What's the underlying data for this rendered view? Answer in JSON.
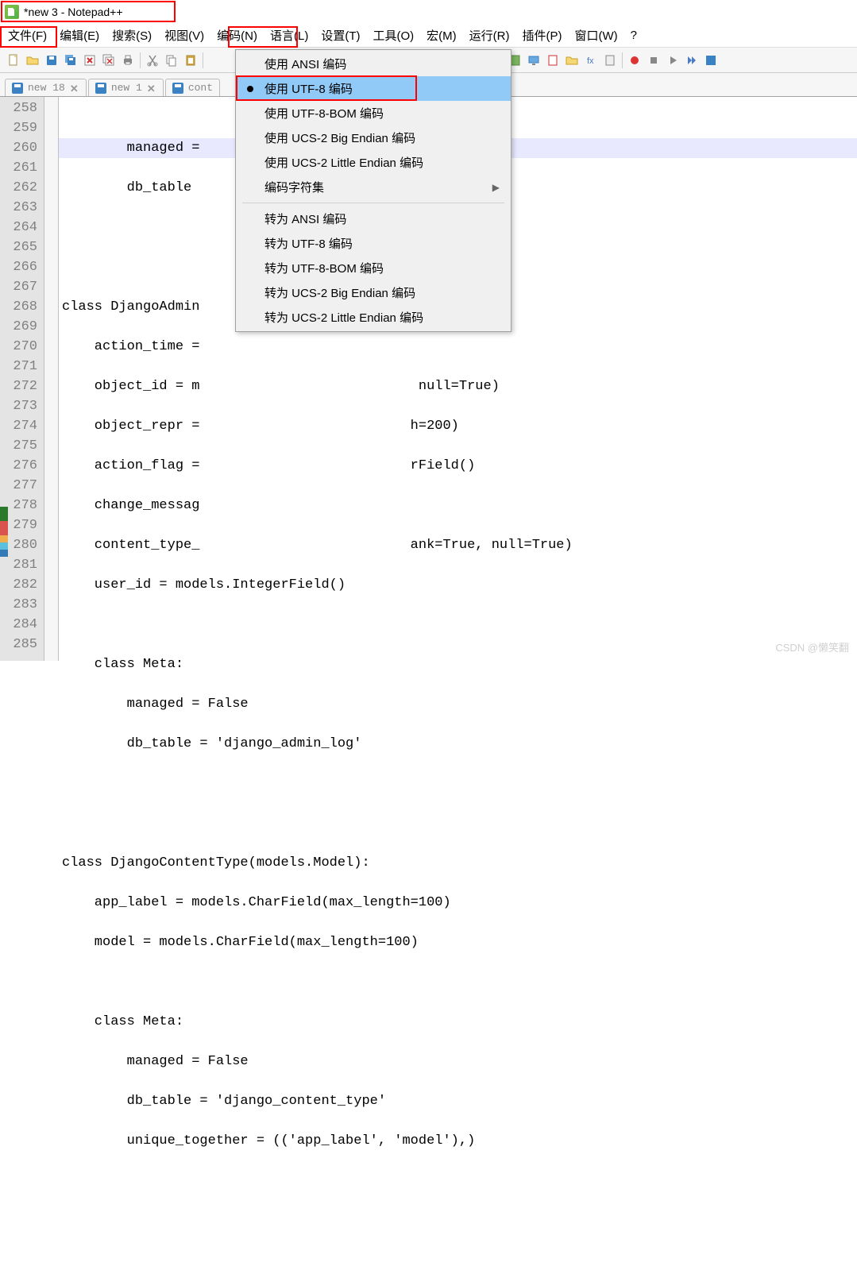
{
  "title": "*new 3 - Notepad++",
  "menu": {
    "file": "文件(F)",
    "edit": "编辑(E)",
    "search": "搜索(S)",
    "view": "视图(V)",
    "encoding": "编码(N)",
    "language": "语言(L)",
    "settings": "设置(T)",
    "tools": "工具(O)",
    "macro": "宏(M)",
    "run": "运行(R)",
    "plugins": "插件(P)",
    "window": "窗口(W)",
    "help": "?"
  },
  "dropdown": {
    "use_ansi": "使用 ANSI 编码",
    "use_utf8": "使用 UTF-8 编码",
    "use_utf8bom": "使用 UTF-8-BOM 编码",
    "use_ucs2be": "使用 UCS-2 Big Endian 编码",
    "use_ucs2le": "使用 UCS-2 Little Endian 编码",
    "charset": "编码字符集",
    "to_ansi": "转为 ANSI 编码",
    "to_utf8": "转为 UTF-8 编码",
    "to_utf8bom": "转为 UTF-8-BOM 编码",
    "to_ucs2be": "转为 UCS-2 Big Endian 编码",
    "to_ucs2le": "转为 UCS-2 Little Endian 编码"
  },
  "tabs": {
    "t1": "new 18",
    "t2": "new 1",
    "t3": "cont"
  },
  "lines": {
    "start": 258,
    "n": [
      "258",
      "259",
      "260",
      "261",
      "262",
      "263",
      "264",
      "265",
      "266",
      "267",
      "268",
      "269",
      "270",
      "271",
      "272",
      "273",
      "274",
      "275",
      "276",
      "277",
      "278",
      "279",
      "280",
      "281",
      "282",
      "283",
      "284",
      "285"
    ]
  },
  "code": {
    "l258": "        managed =",
    "l259": "        db_table",
    "l260": "",
    "l261": "",
    "l262": "class DjangoAdmin",
    "l263": "    action_time =",
    "l264": "    object_id = m                           null=True)",
    "l265": "    object_repr =                          h=200)",
    "l266": "    action_flag =                          rField()",
    "l267": "    change_messag",
    "l268": "    content_type_                          ank=True, null=True)",
    "l269": "    user_id = models.IntegerField()",
    "l270": "",
    "l271": "    class Meta:",
    "l272": "        managed = False",
    "l273": "        db_table = 'django_admin_log'",
    "l274": "",
    "l275": "",
    "l276": "class DjangoContentType(models.Model):",
    "l277": "    app_label = models.CharField(max_length=100)",
    "l278": "    model = models.CharField(max_length=100)",
    "l279": "",
    "l280": "    class Meta:",
    "l281": "        managed = False",
    "l282": "        db_table = 'django_content_type'",
    "l283": "        unique_together = (('app_label', 'model'),)",
    "l284": "",
    "l285": ""
  },
  "watermark": "CSDN @懒笑翻"
}
